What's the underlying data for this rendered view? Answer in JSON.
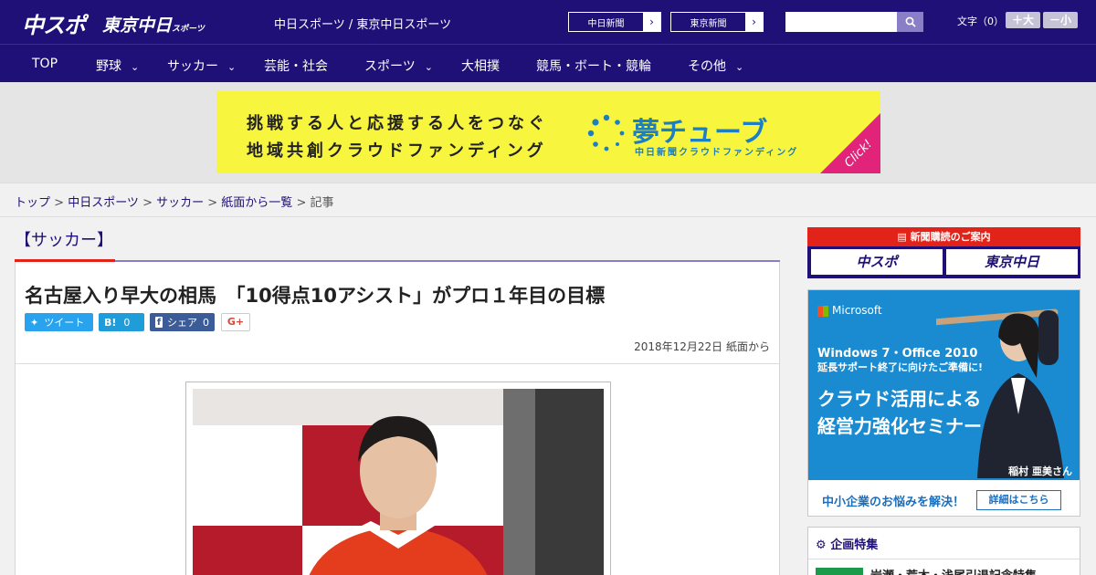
{
  "header": {
    "logo_main": "中スポ",
    "logo_sub": "東京中日",
    "logo_sub_small": "スポーツ",
    "site_links": "中日スポーツ / 東京中日スポーツ",
    "paper_buttons": [
      "中日新聞",
      "東京新聞"
    ],
    "font_size_label": "文字（0）",
    "font_bigger": "＋大",
    "font_smaller": "－小"
  },
  "nav": {
    "items": [
      {
        "label": "TOP",
        "dropdown": false
      },
      {
        "label": "野球",
        "dropdown": true
      },
      {
        "label": "サッカー",
        "dropdown": true
      },
      {
        "label": "芸能・社会",
        "dropdown": false
      },
      {
        "label": "スポーツ",
        "dropdown": true
      },
      {
        "label": "大相撲",
        "dropdown": false
      },
      {
        "label": "競馬・ボート・競輪",
        "dropdown": false
      },
      {
        "label": "その他",
        "dropdown": true
      }
    ]
  },
  "banner": {
    "line1": "挑戦する人と応援する人をつなぐ",
    "line2": "地域共創クラウドファンディング",
    "brand": "夢チューブ",
    "brand_sub": "中日新聞クラウドファンディング",
    "click": "Click!"
  },
  "breadcrumb": {
    "items": [
      "トップ",
      "中日スポーツ",
      "サッカー",
      "紙面から一覧"
    ],
    "current": "記事"
  },
  "article": {
    "category": "【サッカー】",
    "headline": "名古屋入り早大の相馬　「10得点10アシスト」がプロ１年目の目標",
    "share": {
      "tweet": "ツイート",
      "hatena_label": "B!",
      "hatena_count": "0",
      "facebook_label": "シェア",
      "facebook_count": "0",
      "gplus": "G+"
    },
    "date": "2018年12月22日 紙面から"
  },
  "sidebar": {
    "subscribe_heading": "新聞購読のご案内",
    "subscribe_options": [
      "中スポ",
      "東京中日"
    ],
    "ad": {
      "brand": "Microsoft",
      "line1": "Windows 7・Office 2010",
      "line2": "延長サポート終了に向けたご準備に!",
      "headline1": "クラウド活用による",
      "headline2": "経営力強化セミナー",
      "person": "稲村 亜美さん",
      "bottom_text": "中小企業のお悩みを解決！",
      "detail_button": "詳細はこちら"
    },
    "feature_heading": "企画特集",
    "feature_item": "岩瀬・荒木・浅尾引退記念特集"
  },
  "colors": {
    "brand_navy": "#1f1077",
    "accent_red": "#e2231a",
    "banner_yellow": "#f8f53e"
  }
}
